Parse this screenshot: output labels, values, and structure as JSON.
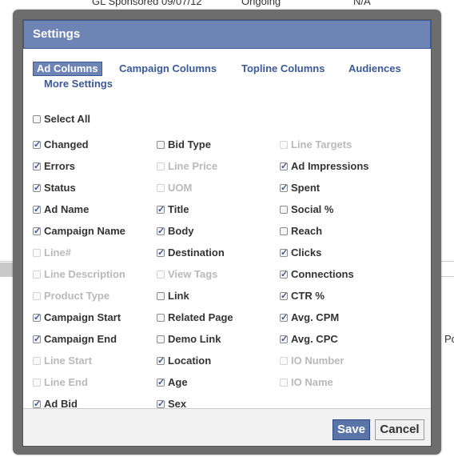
{
  "background": {
    "top_text": [
      "GL Sponsored 09/07/12",
      "Ongoing",
      "N/A"
    ],
    "right_text": "Po"
  },
  "dialog": {
    "title": "Settings",
    "tabs": [
      "Ad Columns",
      "Campaign Columns",
      "Topline Columns",
      "Audiences",
      "More Settings"
    ],
    "active_tab": "Ad Columns",
    "select_all": {
      "label": "Select All",
      "checked": false
    },
    "columns": [
      [
        {
          "label": "Changed",
          "checked": true,
          "enabled": true
        },
        {
          "label": "Errors",
          "checked": true,
          "enabled": true
        },
        {
          "label": "Status",
          "checked": true,
          "enabled": true
        },
        {
          "label": "Ad Name",
          "checked": true,
          "enabled": true
        },
        {
          "label": "Campaign Name",
          "checked": true,
          "enabled": true
        },
        {
          "label": "Line#",
          "checked": false,
          "enabled": false
        },
        {
          "label": "Line Description",
          "checked": false,
          "enabled": false
        },
        {
          "label": "Product Type",
          "checked": false,
          "enabled": false
        },
        {
          "label": "Campaign Start",
          "checked": true,
          "enabled": true
        },
        {
          "label": "Campaign End",
          "checked": true,
          "enabled": true
        },
        {
          "label": "Line Start",
          "checked": false,
          "enabled": false
        },
        {
          "label": "Line End",
          "checked": false,
          "enabled": false
        },
        {
          "label": "Ad Bid",
          "checked": true,
          "enabled": true
        }
      ],
      [
        {
          "label": "Bid Type",
          "checked": false,
          "enabled": true
        },
        {
          "label": "Line Price",
          "checked": false,
          "enabled": false
        },
        {
          "label": "UOM",
          "checked": false,
          "enabled": false
        },
        {
          "label": "Title",
          "checked": true,
          "enabled": true
        },
        {
          "label": "Body",
          "checked": true,
          "enabled": true
        },
        {
          "label": "Destination",
          "checked": true,
          "enabled": true
        },
        {
          "label": "View Tags",
          "checked": false,
          "enabled": false
        },
        {
          "label": "Link",
          "checked": false,
          "enabled": true
        },
        {
          "label": "Related Page",
          "checked": false,
          "enabled": true
        },
        {
          "label": "Demo Link",
          "checked": false,
          "enabled": true
        },
        {
          "label": "Location",
          "checked": true,
          "enabled": true
        },
        {
          "label": "Age",
          "checked": true,
          "enabled": true
        },
        {
          "label": "Sex",
          "checked": true,
          "enabled": true
        }
      ],
      [
        {
          "label": "Line Targets",
          "checked": false,
          "enabled": false
        },
        {
          "label": "Ad Impressions",
          "checked": true,
          "enabled": true
        },
        {
          "label": "Spent",
          "checked": true,
          "enabled": true
        },
        {
          "label": "Social %",
          "checked": false,
          "enabled": true
        },
        {
          "label": "Reach",
          "checked": false,
          "enabled": true
        },
        {
          "label": "Clicks",
          "checked": true,
          "enabled": true
        },
        {
          "label": "Connections",
          "checked": true,
          "enabled": true
        },
        {
          "label": "CTR %",
          "checked": true,
          "enabled": true
        },
        {
          "label": "Avg. CPM",
          "checked": true,
          "enabled": true
        },
        {
          "label": "Avg. CPC",
          "checked": true,
          "enabled": true
        },
        {
          "label": "IO Number",
          "checked": false,
          "enabled": false
        },
        {
          "label": "IO Name",
          "checked": false,
          "enabled": false
        }
      ]
    ],
    "buttons": {
      "save": "Save",
      "cancel": "Cancel"
    }
  },
  "colors": {
    "title_bar": "#6d84b4",
    "link_blue": "#3b5998",
    "disabled_text": "#b9b9b9"
  }
}
